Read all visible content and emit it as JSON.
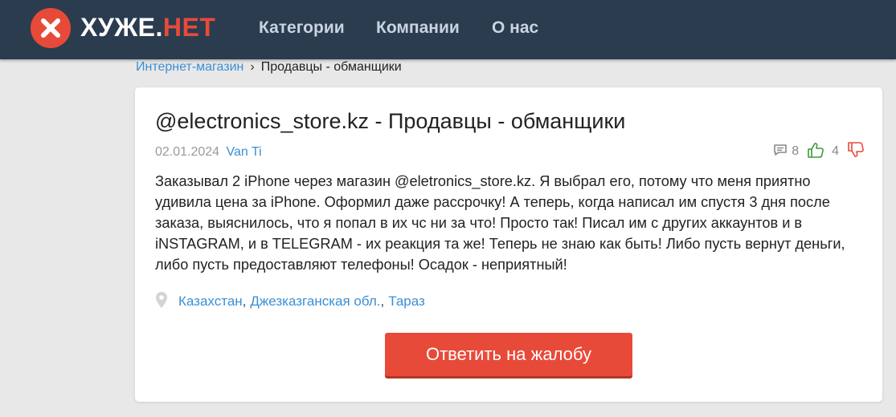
{
  "header": {
    "logo": {
      "part1": "ХУЖЕ.",
      "part2": "НЕТ",
      "icon": "x-close-icon"
    },
    "nav": [
      "Категории",
      "Компании",
      "О нас"
    ]
  },
  "breadcrumb": {
    "link": "Интернет-магазин",
    "separator": "›",
    "current": "Продавцы - обманщики"
  },
  "complaint": {
    "title": "@electronics_store.kz - Продавцы - обманщики",
    "date": "02.01.2024",
    "author": "Van Ti",
    "comments_count": "8",
    "likes_count": "4",
    "body": "Заказывал 2 iPhone через магазин @eletronics_store.kz. Я выбрал его, потому что меня приятно удивила цена за iPhone. Оформил даже рассрочку! А теперь, когда написал им спустя 3 дня после заказа, выяснилось, что я попал в их чс ни за что! Просто так! Писал им с других аккаунтов и в iNSTAGRAM, и в TELEGRAM - их реакция та же! Теперь не знаю как быть! Либо пусть вернут деньги, либо пусть предоставляют телефоны! Осадок - неприятный!",
    "location": {
      "country": "Казахстан",
      "region": "Джезказганская обл.",
      "city": "Тараз",
      "icon": "map-pin-icon"
    },
    "reply_button": "Ответить на жалобу"
  },
  "colors": {
    "header_bg": "#2b3c4f",
    "accent_red": "#e84a3a",
    "link_blue": "#3a8fd4",
    "like_green": "#3a9a3a",
    "page_bg": "#e8e8e8"
  }
}
